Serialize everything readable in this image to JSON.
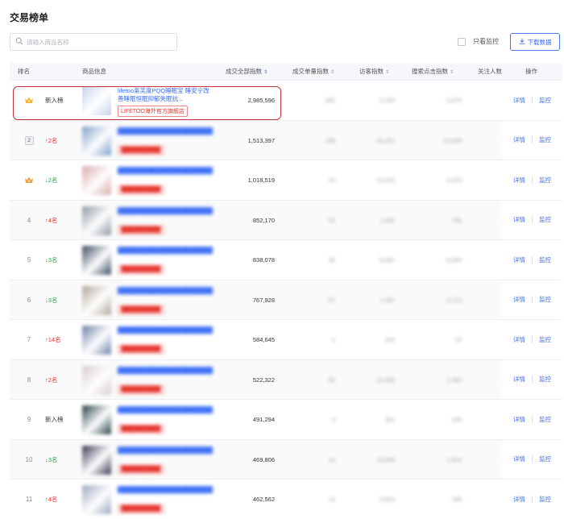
{
  "page": {
    "title": "交易榜单"
  },
  "search": {
    "placeholder": "请输入商品名称"
  },
  "toolbar": {
    "only_monitor_label": "只看监控",
    "download_label": "下载数据"
  },
  "columns": {
    "rank": "排名",
    "product": "商品信息",
    "total": "成交全部指数",
    "single": "成交单量指数",
    "visitor": "访客指数",
    "search_clicks": "搜索点击指数",
    "followers": "关注人数",
    "ops": "操作"
  },
  "ops_labels": {
    "detail": "详情",
    "monitor": "监控"
  },
  "rows": [
    {
      "rank": "1",
      "rank_style": "crown-gold",
      "change": "新入榜",
      "dir": "new",
      "title": "lifetoo莱芙度PQQ睡眠宝 睡安宁改善睡眠恒眠抑郁失眠抗...",
      "shop": "LIFETOO海外官方旗舰店",
      "total": "2,985,596",
      "single": "382",
      "visitor": "2,193",
      "search": "3,470",
      "thumb": "#c6d4ec",
      "blur": false
    },
    {
      "rank": "2",
      "rank_style": "medal",
      "change": "2名",
      "dir": "up",
      "title": "████████████████████████",
      "shop": "██████████",
      "total": "1,513,397",
      "single": "199",
      "visitor": "18,291",
      "search": "10,008",
      "thumb": "#7b9fc9",
      "blur": true
    },
    {
      "rank": "3",
      "rank_style": "crown-bronze",
      "change": "2名",
      "dir": "down",
      "title": "████████████████████████",
      "shop": "██████████",
      "total": "1,018,519",
      "single": "24",
      "visitor": "12,623",
      "search": "3,470",
      "thumb": "#d9a9a9",
      "blur": true
    },
    {
      "rank": "4",
      "rank_style": "num",
      "change": "4名",
      "dir": "up",
      "title": "████████████████████████",
      "shop": "██████████",
      "total": "852,170",
      "single": "52",
      "visitor": "1,454",
      "search": "785",
      "thumb": "#8c96a3",
      "blur": true
    },
    {
      "rank": "5",
      "rank_style": "num",
      "change": "3名",
      "dir": "down",
      "title": "████████████████████████",
      "shop": "██████████",
      "total": "838,078",
      "single": "39",
      "visitor": "8,091",
      "search": "8,094",
      "thumb": "#35475d",
      "blur": true
    },
    {
      "rank": "6",
      "rank_style": "num",
      "change": "3名",
      "dir": "down",
      "title": "████████████████████████",
      "shop": "██████████",
      "total": "767,928",
      "single": "67",
      "visitor": "7,097",
      "search": "2,713",
      "thumb": "#b0a597",
      "blur": true
    },
    {
      "rank": "7",
      "rank_style": "num",
      "change": "14名",
      "dir": "up",
      "title": "████████████████████████",
      "shop": "██████████",
      "total": "584,645",
      "single": "4",
      "visitor": "234",
      "search": "23",
      "thumb": "#6c7fa8",
      "blur": true
    },
    {
      "rank": "8",
      "rank_style": "num",
      "change": "2名",
      "dir": "up",
      "title": "████████████████████████",
      "shop": "██████████",
      "total": "522,322",
      "single": "82",
      "visitor": "16,459",
      "search": "1,364",
      "thumb": "#d8cccc",
      "blur": true
    },
    {
      "rank": "9",
      "rank_style": "num",
      "change": "新入榜",
      "dir": "new",
      "title": "████████████████████████",
      "shop": "██████████",
      "total": "491,294",
      "single": "4",
      "visitor": "301",
      "search": "195",
      "thumb": "#253f46",
      "blur": true
    },
    {
      "rank": "10",
      "rank_style": "num",
      "change": "3名",
      "dir": "down",
      "title": "████████████████████████",
      "shop": "██████████",
      "total": "469,806",
      "single": "14",
      "visitor": "13,849",
      "search": "1,814",
      "thumb": "#3a3550",
      "blur": true
    },
    {
      "rank": "11",
      "rank_style": "num",
      "change": "4名",
      "dir": "up",
      "title": "████████████████████████",
      "shop": "██████████",
      "total": "462,562",
      "single": "14",
      "visitor": "3,693",
      "search": "785",
      "thumb": "#9aa7c0",
      "blur": true
    }
  ]
}
